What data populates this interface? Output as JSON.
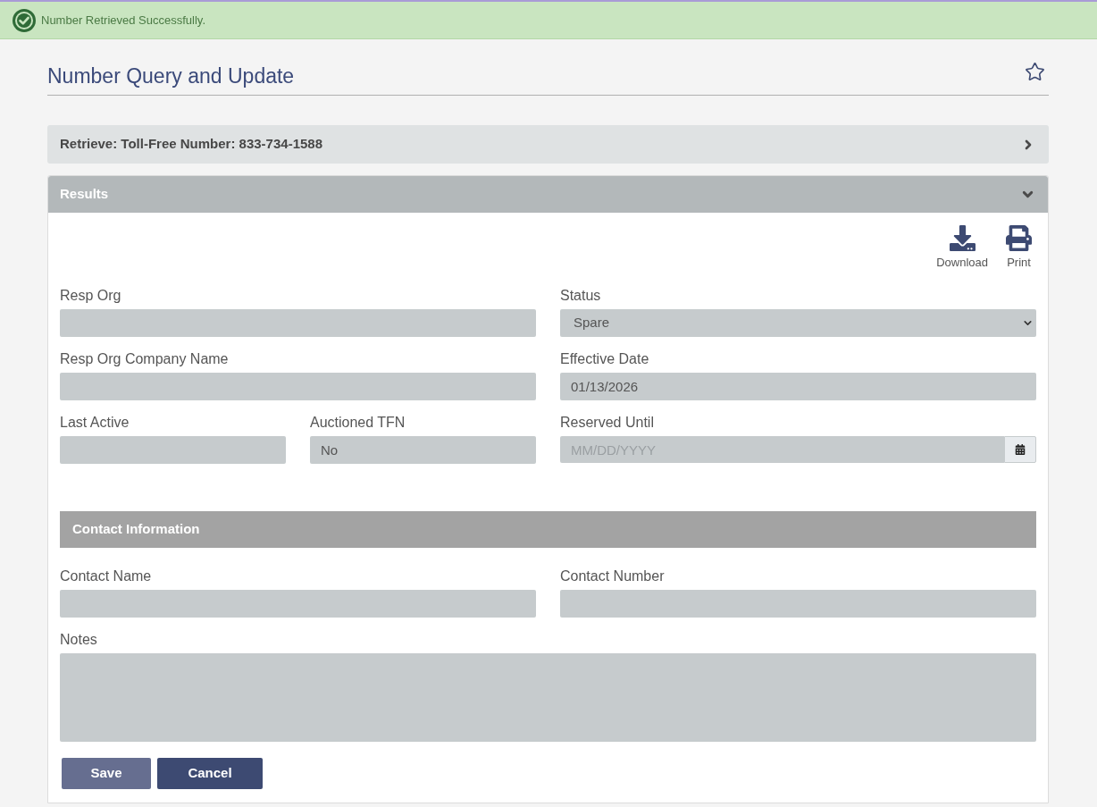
{
  "alert": {
    "kind": "success",
    "message": "Number Retrieved Successfully."
  },
  "page": {
    "title": "Number Query and Update",
    "favorite": false
  },
  "retrieve_panel": {
    "title": "Retrieve: Toll-Free Number: 833-734-1588",
    "expanded": false
  },
  "results_panel": {
    "title": "Results",
    "expanded": true,
    "actions": [
      {
        "kind": "download",
        "label": "Download"
      },
      {
        "kind": "print",
        "label": "Print"
      }
    ],
    "rows": [
      [
        [
          {
            "kind": "text",
            "label": "Resp Org"
          }
        ],
        [
          {
            "kind": "select",
            "label": "Status",
            "value": "Spare"
          }
        ]
      ],
      [
        [
          {
            "kind": "text",
            "label": "Resp Org Company Name"
          }
        ],
        [
          {
            "kind": "text",
            "label": "Effective Date",
            "value": "01/13/2026"
          }
        ]
      ],
      [
        [
          {
            "kind": "text",
            "label": "Last Active"
          },
          {
            "kind": "text",
            "label": "Auctioned TFN",
            "value": "No"
          }
        ],
        [
          {
            "kind": "date",
            "label": "Reserved Until",
            "placeholder": "MM/DD/YYYY"
          }
        ]
      ]
    ],
    "contact_section": {
      "title": "Contact Information",
      "rows": [
        [
          [
            {
              "kind": "text",
              "label": "Contact Name"
            }
          ],
          [
            {
              "kind": "text",
              "label": "Contact Number"
            }
          ]
        ],
        [
          [
            {
              "kind": "textarea",
              "label": "Notes"
            }
          ]
        ]
      ]
    },
    "buttons": [
      {
        "label": "Save",
        "disabled": true
      },
      {
        "label": "Cancel",
        "disabled": false
      }
    ]
  }
}
